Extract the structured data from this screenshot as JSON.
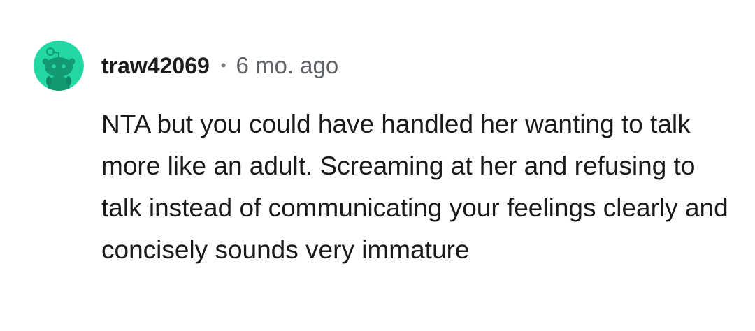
{
  "comment": {
    "avatar_icon": "snoo-avatar-icon",
    "avatar_bg": "#24d8a5",
    "username": "traw42069",
    "separator": "•",
    "timestamp": "6 mo. ago",
    "text": "NTA but you could have handled her wanting to talk more like an adult. Screaming at her and refusing to talk instead of communicating your feelings clearly and concisely sounds very immature"
  }
}
